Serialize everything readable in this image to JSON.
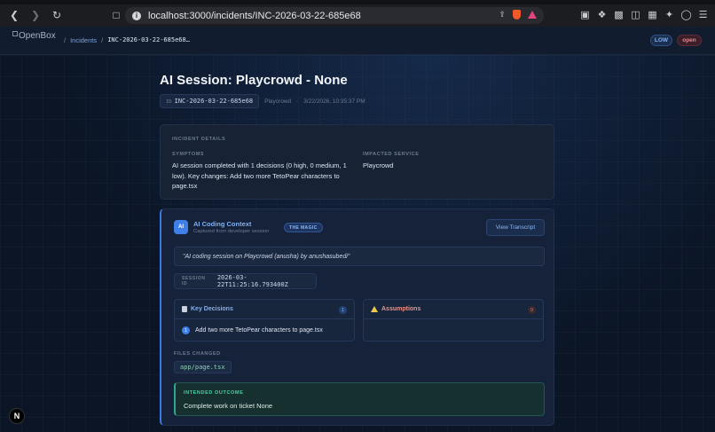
{
  "browser": {
    "url": "localhost:3000/incidents/INC-2026-03-22-685e68"
  },
  "header": {
    "logo_alt": "OpenBox",
    "breadcrumb": {
      "separator": "/",
      "incidents": "Incidents",
      "current": "INC-2026-03-22-685e68…"
    },
    "severity": "LOW",
    "status": "open"
  },
  "incident": {
    "title": "AI Session: Playcrowd - None",
    "id_label": "ID",
    "id": "INC-2026-03-22-685e68",
    "service": "Playcrowd",
    "dot": "·",
    "timestamp": "3/22/2026, 10:35:37 PM"
  },
  "details": {
    "heading": "INCIDENT DETAILS",
    "symptoms_label": "SYMPTOMS",
    "symptoms": "AI session completed with 1 decisions (0 high, 0 medium, 1 low). Key changes: Add two more TetoPear characters to page.tsx",
    "service_label": "IMPACTED SERVICE",
    "service": "Playcrowd"
  },
  "ai_context": {
    "icon_text": "AI",
    "title": "AI Coding Context",
    "subtitle": "Captured from developer session",
    "badge": "THE MAGIC",
    "transcript_button": "View Transcript",
    "quote": "\"AI coding session on Playcrowd (anusha) by anushasubedi\"",
    "session_label": "SESSION ID",
    "session_id": "2026-03-22T11:25:16.793400Z",
    "decisions": {
      "title": "Key Decisions",
      "count": "1",
      "items": [
        {
          "num": "1",
          "text": "Add two more TetoPear characters to page.tsx"
        }
      ]
    },
    "assumptions": {
      "title": "Assumptions",
      "count": "0"
    },
    "files_label": "FILES CHANGED",
    "files": [
      "app/page.tsx"
    ],
    "outcome_label": "INTENDED OUTCOME",
    "outcome": "Complete work on ticket None"
  },
  "dev_badge": "N",
  "colors": {
    "accent": "#3f7fe8",
    "success": "#32a58a",
    "danger": "#e48a96"
  }
}
